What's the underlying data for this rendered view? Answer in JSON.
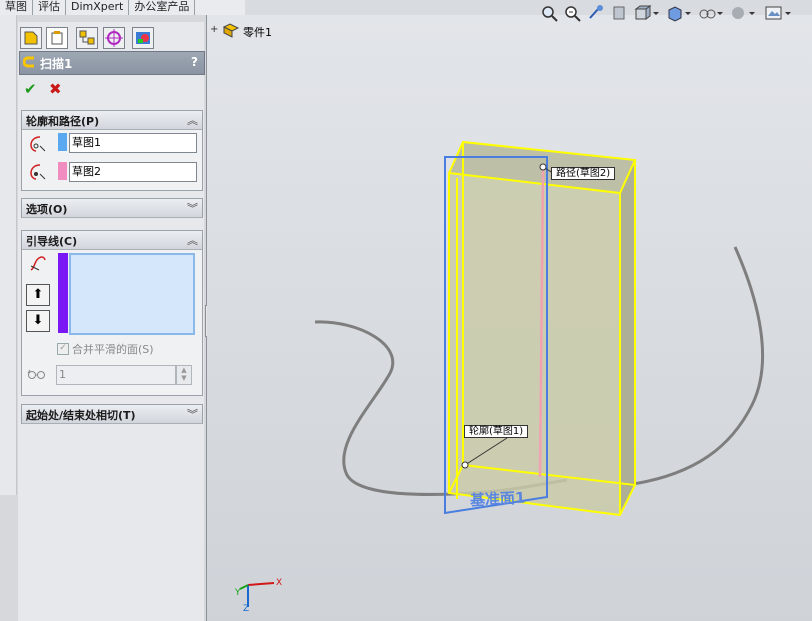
{
  "command_tabs": [
    "草图",
    "评估",
    "DimXpert",
    "办公室产品"
  ],
  "feature_tree": {
    "expander": "+",
    "root_label": "零件1"
  },
  "property_manager": {
    "title": "扫描1",
    "help": "?",
    "ok_symbol": "✔",
    "cancel_symbol": "✖",
    "profile_path_group": {
      "header": "轮廓和路径(P)",
      "profile_value": "草图1",
      "path_value": "草图2",
      "profile_color": "#5aa9f0",
      "path_color": "#f08cc0"
    },
    "options_group": {
      "header": "选项(O)"
    },
    "guide_group": {
      "header": "引导线(C)",
      "list_color": "#7a18f5",
      "up_arrow": "⬆",
      "down_arrow": "⬇",
      "merge_label": "合并平滑的面(S)",
      "merge_checked": true,
      "spin_value": "1"
    },
    "tangency_group": {
      "header": "起始处/结束处相切(T)"
    }
  },
  "viewport": {
    "path_label": "路径(草图2)",
    "profile_label": "轮廓(草图1)",
    "plane_label": "基准面1",
    "triad": {
      "x": "X",
      "y": "Y",
      "z": "Z"
    }
  }
}
